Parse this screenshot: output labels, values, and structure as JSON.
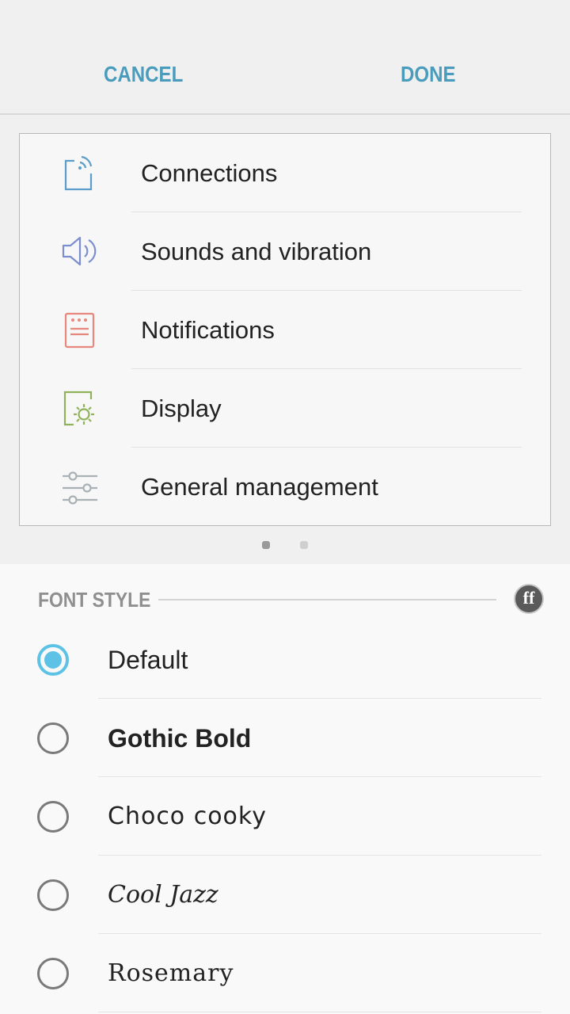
{
  "topbar": {
    "cancel_label": "CANCEL",
    "done_label": "DONE",
    "accent_color": "#4a9cbd"
  },
  "preview": {
    "items": [
      {
        "label": "Connections",
        "icon": "connections-icon",
        "color": "#5b9ec9"
      },
      {
        "label": "Sounds and vibration",
        "icon": "speaker-icon",
        "color": "#7b8fd0"
      },
      {
        "label": "Notifications",
        "icon": "notifications-icon",
        "color": "#e8877d"
      },
      {
        "label": "Display",
        "icon": "display-brightness-icon",
        "color": "#8fb25a"
      },
      {
        "label": "General management",
        "icon": "sliders-icon",
        "color": "#a9b1b5"
      }
    ],
    "page_indicator": {
      "current": 1,
      "total": 2
    }
  },
  "font_style": {
    "section_title": "FONT STYLE",
    "options": [
      {
        "label": "Default",
        "selected": true
      },
      {
        "label": "Gothic Bold",
        "selected": false
      },
      {
        "label": "Choco cooky",
        "selected": false
      },
      {
        "label": "Cool Jazz",
        "selected": false
      },
      {
        "label": "Rosemary",
        "selected": false
      }
    ],
    "selected_color": "#5ec2e6",
    "download_icon_label": "ff"
  }
}
